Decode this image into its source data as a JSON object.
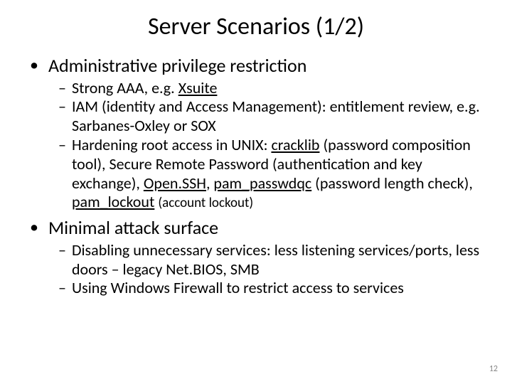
{
  "title": "Server Scenarios (1/2)",
  "items": [
    {
      "label": "Administrative privilege restriction",
      "sub": [
        {
          "html": "Strong AAA, e.g. <span class='u'>Xsuite</span>"
        },
        {
          "html": "IAM (identity and Access Management): entitlement review, e.g. Sarbanes-Oxley or SOX"
        },
        {
          "html": "Hardening root access in UNIX: <span class='u'>cracklib</span> (password composition tool), Secure Remote Password (authentication and key exchange), <span class='u'>Open.SSH</span>, <span class='u'>pam_passwdqc</span> (password length check), <span class='u'>pam_lockout</span> <span class='small-sub'>(account lockout)</span>"
        }
      ]
    },
    {
      "label": "Minimal attack surface",
      "sub": [
        {
          "html": "Disabling unnecessary services: less listening services/ports, less doors – legacy Net.BIOS, SMB"
        },
        {
          "html": "Using Windows Firewall to restrict access to services"
        }
      ]
    }
  ],
  "page_number": "12"
}
